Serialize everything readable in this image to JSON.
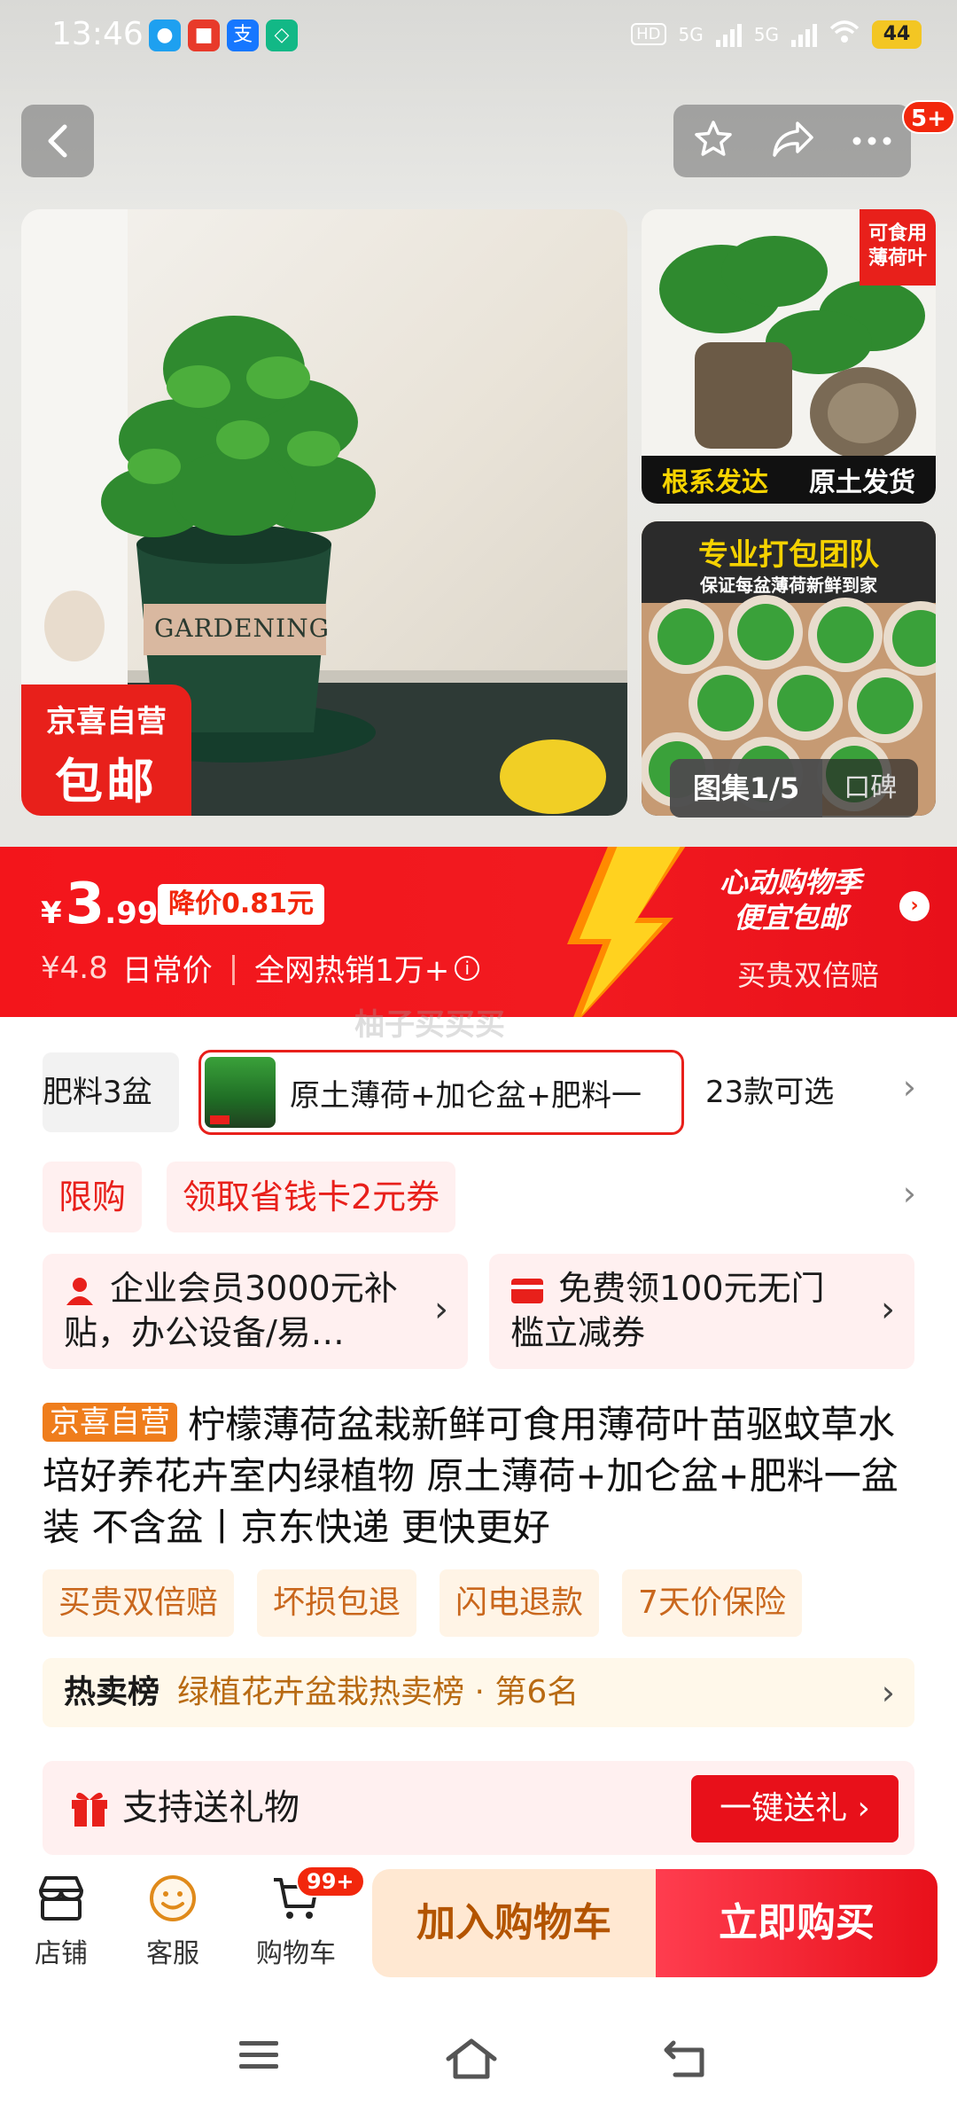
{
  "status_bar": {
    "time": "13:46",
    "network_labels": [
      "5G",
      "5G"
    ],
    "battery": "44"
  },
  "header": {
    "more_badge": "5+",
    "icons": [
      "back-icon",
      "star-icon",
      "share-icon",
      "more-icon"
    ]
  },
  "gallery": {
    "main_tag_line1": "京喜自营",
    "main_tag_line2": "包邮",
    "pot_text": "GARDENING",
    "side1_tag": "可食用薄荷叶",
    "side1_banner_left": "根系发达",
    "side1_banner_right": "原土发货",
    "side2_title": "专业打包团队",
    "side2_subtitle": "保证每盆薄荷新鲜到家",
    "gallery_label": "图集1/5",
    "reviews_label": "口碑"
  },
  "price": {
    "currency": "¥",
    "integer": "3",
    "decimal": ".99",
    "drop_label": "降价0.81元",
    "original": "¥4.8",
    "original_label": "日常价",
    "hot_sales": "全网热销1万+",
    "promo_line1": "心动购物季",
    "promo_line2": "便宜包邮",
    "promo_sub": "买贵双倍赔",
    "accent": "#f2270c"
  },
  "watermark": "柚子买买买",
  "sku": {
    "prev_label": "肥料3盆",
    "current_label": "原土薄荷+加仑盆+肥料一",
    "count_label": "23款可选"
  },
  "coupons": {
    "limit_label": "限购",
    "coupon_label": "领取省钱卡2元券"
  },
  "benefits": [
    {
      "text": "企业会员3000元补贴，办公设备/易…"
    },
    {
      "text": "免费领100元无门槛立减券"
    }
  ],
  "product": {
    "badge": "京喜自营",
    "title": "柠檬薄荷盆栽新鲜可食用薄荷叶苗驱蚊草水培好养花卉室内绿植物 原土薄荷+加仑盆+肥料一盆装 不含盆丨京东快递 更快更好"
  },
  "services": [
    "买贵双倍赔",
    "坏损包退",
    "闪电退款",
    "7天价保险"
  ],
  "ranking": {
    "label": "热卖榜",
    "value": "绿植花卉盆栽热卖榜 · 第6名"
  },
  "gift": {
    "label": "支持送礼物",
    "button": "一键送礼 ›"
  },
  "bottom_bar": {
    "store_label": "店铺",
    "service_label": "客服",
    "cart_label": "购物车",
    "cart_badge": "99+",
    "add_to_cart": "加入购物车",
    "buy_now": "立即购买"
  }
}
